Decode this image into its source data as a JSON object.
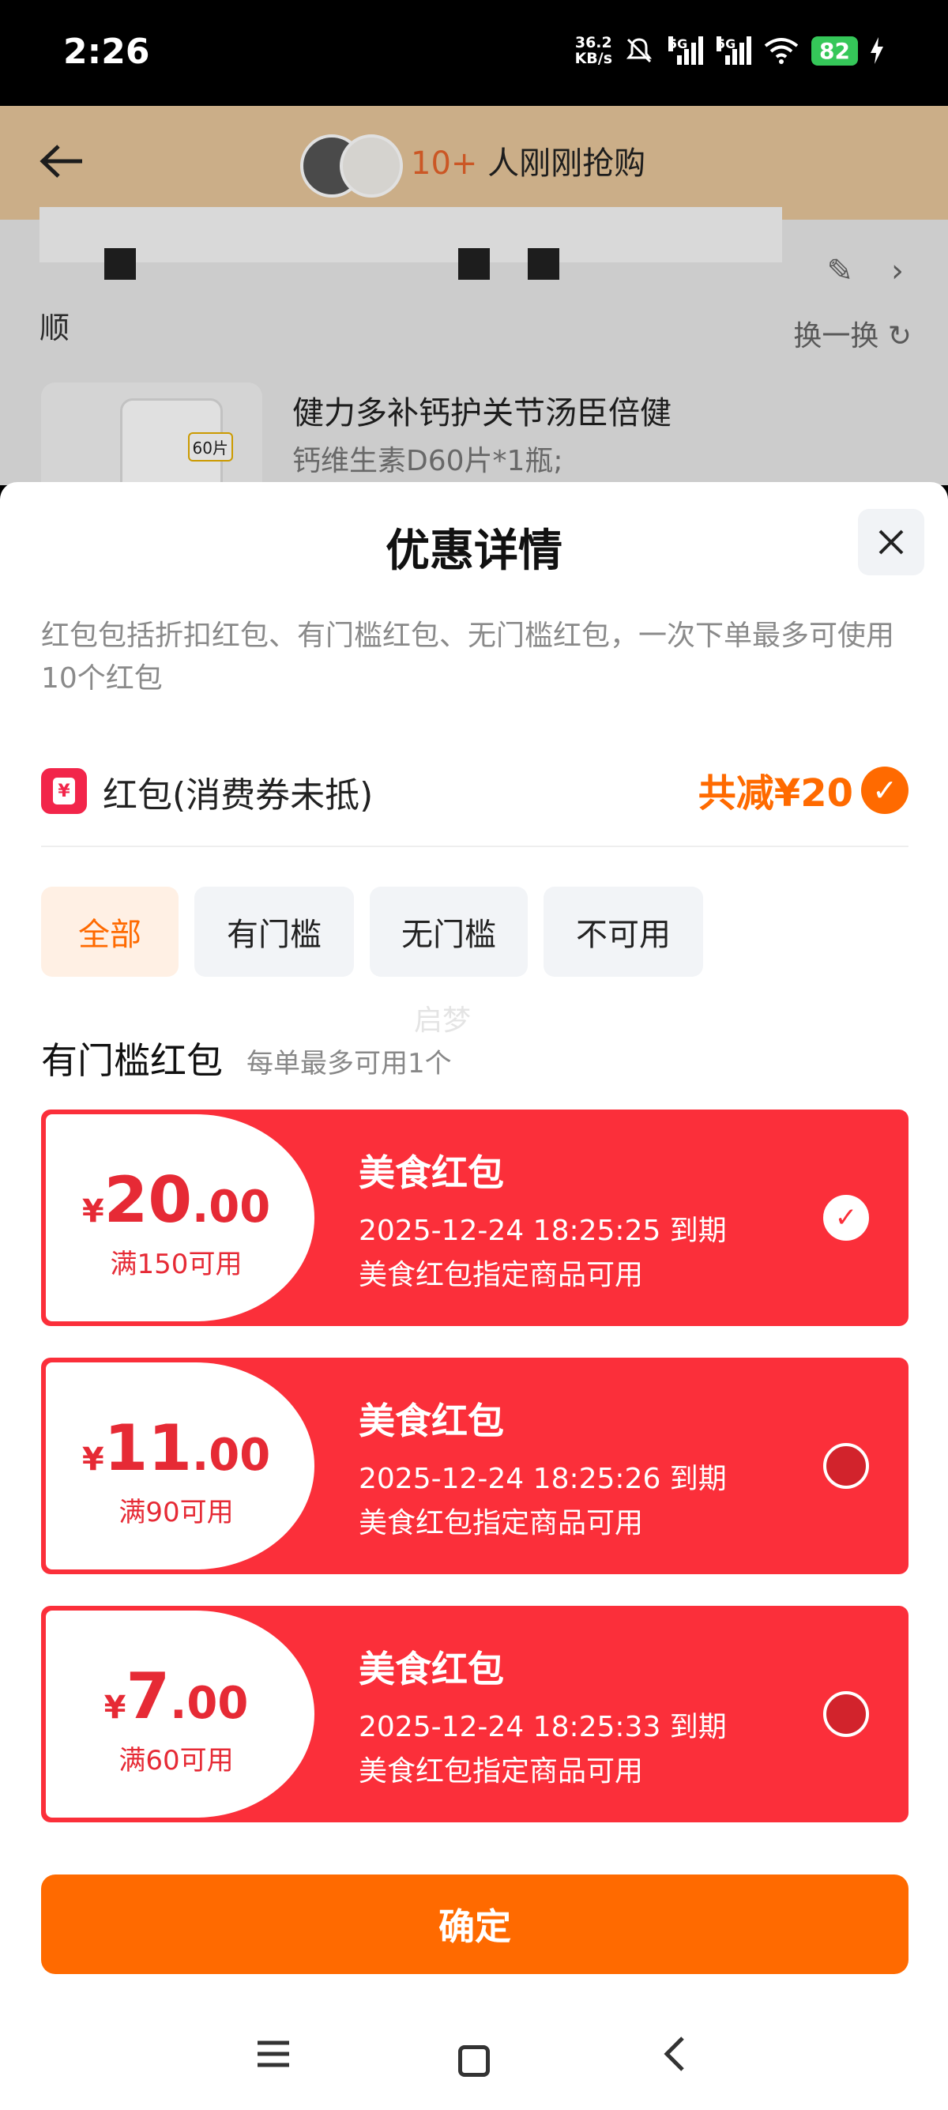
{
  "status_bar": {
    "time": "2:26",
    "net_speed_value": "36.2",
    "net_speed_unit": "KB/s",
    "signal1_label": "5G",
    "signal2_label": "5G",
    "battery": "82"
  },
  "background_page": {
    "buyers_count": "10+",
    "buyers_text": "人刚刚抢购",
    "section_title": "顺",
    "swap_label": "换一换",
    "product_title": "健力多补钙护关节汤臣倍健",
    "product_subtitle": "钙维生素D60片*1瓶;",
    "product_badge": "60片"
  },
  "sheet": {
    "title": "优惠详情",
    "description": "红包包括折扣红包、有门槛红包、无门槛红包，一次下单最多可使用10个红包",
    "redpacket_label": "红包(消费券未抵)",
    "redpacket_icon": "¥",
    "total_discount": "共减¥20",
    "tabs": [
      {
        "label": "全部",
        "active": true
      },
      {
        "label": "有门槛",
        "active": false
      },
      {
        "label": "无门槛",
        "active": false
      },
      {
        "label": "不可用",
        "active": false
      }
    ],
    "watermark": "启梦",
    "section_title": "有门槛红包",
    "section_sub": "每单最多可用1个",
    "coupons": [
      {
        "currency": "¥",
        "amount_int": "20",
        "amount_dec": ".00",
        "condition": "满150可用",
        "name": "美食红包",
        "expire": "2025-12-24 18:25:25 到期",
        "scope": "美食红包指定商品可用",
        "selected": true
      },
      {
        "currency": "¥",
        "amount_int": "11",
        "amount_dec": ".00",
        "condition": "满90可用",
        "name": "美食红包",
        "expire": "2025-12-24 18:25:26 到期",
        "scope": "美食红包指定商品可用",
        "selected": false
      },
      {
        "currency": "¥",
        "amount_int": "7",
        "amount_dec": ".00",
        "condition": "满60可用",
        "name": "美食红包",
        "expire": "2025-12-24 18:25:33 到期",
        "scope": "美食红包指定商品可用",
        "selected": false
      }
    ],
    "confirm_label": "确定"
  },
  "colors": {
    "accent": "#ff6a00",
    "coupon_red": "#fb2f3a"
  }
}
